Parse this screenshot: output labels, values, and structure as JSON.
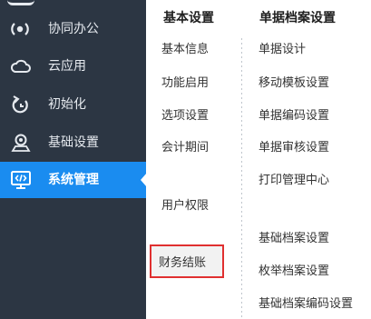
{
  "sidebar": {
    "items": [
      {
        "label": "协同办公",
        "icon": "signal-broadcast-icon"
      },
      {
        "label": "云应用",
        "icon": "cloud-icon"
      },
      {
        "label": "初始化",
        "icon": "refresh-icon"
      },
      {
        "label": "基础设置",
        "icon": "settings-person-icon"
      },
      {
        "label": "系统管理",
        "icon": "code-monitor-icon",
        "active": true
      }
    ],
    "background": "#2c3643",
    "active_color": "#1a8cf0"
  },
  "basic_settings": {
    "title": "基本设置",
    "items": [
      "基本信息",
      "功能启用",
      "选项设置",
      "会计期间",
      "用户权限",
      "财务结账"
    ],
    "highlighted_item": "财务结账"
  },
  "document_settings": {
    "title": "单据档案设置",
    "items": [
      "单据设计",
      "移动模板设置",
      "单据编码设置",
      "单据审核设置",
      "打印管理中心",
      "基础档案设置",
      "枚举档案设置",
      "基础档案编码设置"
    ]
  },
  "colors": {
    "highlight_border": "#e03030"
  }
}
